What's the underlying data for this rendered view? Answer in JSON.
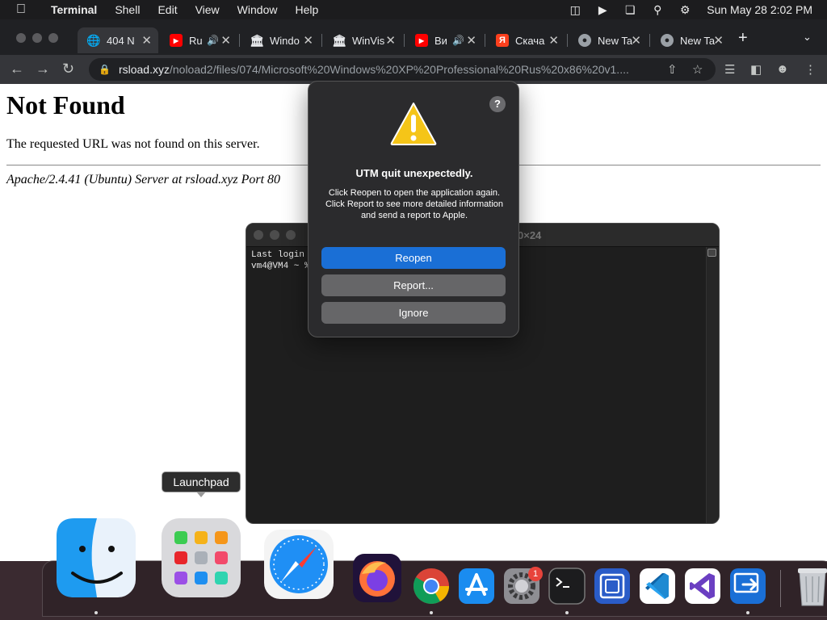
{
  "menubar": {
    "app_name": "Terminal",
    "items": [
      "Shell",
      "Edit",
      "View",
      "Window",
      "Help"
    ],
    "clock": "Sun May 28  2:02 PM"
  },
  "browser": {
    "tabs": [
      {
        "label": "404 N",
        "favicon": "globe-icon",
        "active": true
      },
      {
        "label": "Ru",
        "favicon": "youtube-icon",
        "audio": true
      },
      {
        "label": "Windo",
        "favicon": "archive-icon"
      },
      {
        "label": "WinVis",
        "favicon": "archive-icon"
      },
      {
        "label": "Ви",
        "favicon": "youtube-icon",
        "audio": true
      },
      {
        "label": "Скача",
        "favicon": "yandex-icon"
      },
      {
        "label": "New Ta",
        "favicon": "chrome-icon"
      },
      {
        "label": "New Ta",
        "favicon": "chrome-icon"
      }
    ],
    "url_host": "rsload.xyz",
    "url_path": "/noload2/files/074/Microsoft%20Windows%20XP%20Professional%20Rus%20x86%20v1...."
  },
  "page": {
    "heading": "Not Found",
    "message": "The requested URL was not found on this server.",
    "address": "Apache/2.4.41 (Ubuntu) Server at rsload.xyz Port 80"
  },
  "terminal": {
    "title_fragment": "0×24",
    "lines": [
      "Last login",
      "vm4@VM4 ~ %"
    ]
  },
  "alert": {
    "title": "UTM quit unexpectedly.",
    "text": "Click Reopen to open the application again. Click Report to see more detailed information and send a report to Apple.",
    "help": "?",
    "buttons": {
      "reopen": "Reopen",
      "report": "Report...",
      "ignore": "Ignore"
    }
  },
  "dock": {
    "tooltip": "Launchpad",
    "settings_badge": "1",
    "items": [
      "Finder",
      "Launchpad",
      "Safari",
      "Firefox",
      "Chrome",
      "App Store",
      "System Settings",
      "Terminal",
      "UTM",
      "VS Code",
      "Visual Studio",
      "Remote Desktop",
      "Trash"
    ]
  },
  "colors": {
    "accent_blue": "#1a6fd6",
    "warning_yellow": "#f5c518",
    "badge_red": "#e8433b"
  }
}
